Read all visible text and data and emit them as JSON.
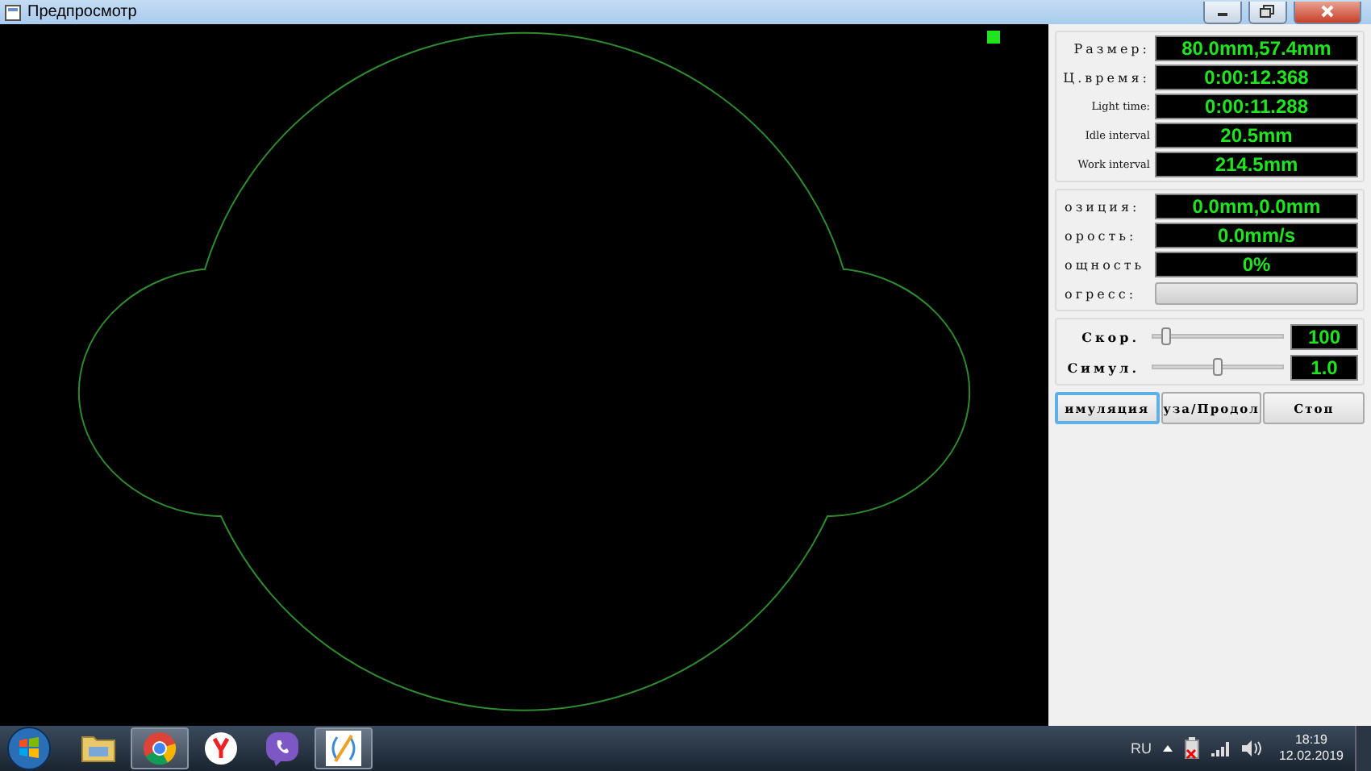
{
  "window": {
    "title": "Предпросмотр"
  },
  "info_rows": [
    {
      "label": "Размер:",
      "value": "80.0mm,57.4mm",
      "kind": "spaced"
    },
    {
      "label": "Ц.время:",
      "value": "0:00:12.368",
      "kind": "spaced"
    },
    {
      "label": "Light time:",
      "value": "0:00:11.288",
      "kind": "small"
    },
    {
      "label": "Idle interval",
      "value": "20.5mm",
      "kind": "small"
    },
    {
      "label": "Work interval",
      "value": "214.5mm",
      "kind": "small"
    }
  ],
  "status_rows": [
    {
      "label": "озиция:",
      "kind": "readout",
      "value": "0.0mm,0.0mm"
    },
    {
      "label": "орость:",
      "kind": "readout",
      "value": "0.0mm/s"
    },
    {
      "label": "ощность",
      "kind": "readout",
      "value": "0%"
    },
    {
      "label": "огресс:",
      "kind": "progress",
      "level": 0
    }
  ],
  "sliders": [
    {
      "label": "Скор.",
      "level": 0.1,
      "value": "100"
    },
    {
      "label": "Симул.",
      "level": 0.5,
      "value": "1.0"
    }
  ],
  "buttons": [
    {
      "label": "имуляция",
      "selected": true
    },
    {
      "label": "уза/Продол",
      "selected": false
    },
    {
      "label": "Стоп",
      "selected": false
    }
  ],
  "taskbar": {
    "apps": [
      {
        "kind": "folder",
        "active": false
      },
      {
        "kind": "browser",
        "active": true
      },
      {
        "kind": "yandex",
        "active": false
      },
      {
        "kind": "viber",
        "active": false
      },
      {
        "kind": "laser",
        "active": true
      }
    ],
    "language": "RU",
    "time": "18:19",
    "date": "12.02.2019"
  }
}
